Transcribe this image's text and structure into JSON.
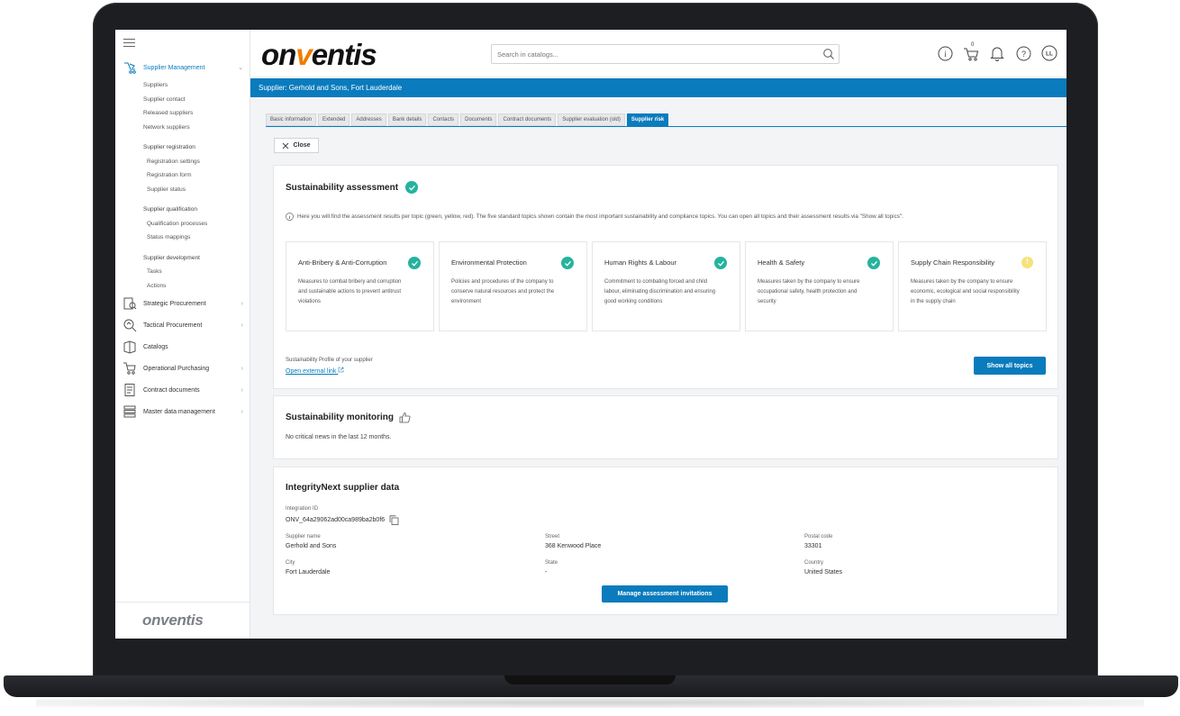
{
  "sidebar": {
    "supplier_management": "Supplier Management",
    "suppliers": "Suppliers",
    "supplier_contact": "Supplier contact",
    "released_suppliers": "Released suppliers",
    "network_suppliers": "Network suppliers",
    "supplier_registration": "Supplier registration",
    "registration_settings": "Registration settings",
    "registration_form": "Registration form",
    "supplier_status": "Supplier status",
    "supplier_qualification": "Supplier qualification",
    "qualification_processes": "Qualification processes",
    "status_mappings": "Status mappings",
    "supplier_development": "Supplier development",
    "tasks": "Tasks",
    "actions": "Actions",
    "strategic_procurement": "Strategic Procurement",
    "tactical_procurement": "Tactical Procurement",
    "catalogs": "Catalogs",
    "operational_purchasing": "Operational Purchasing",
    "contract_documents": "Contract documents",
    "master_data_management": "Master data management",
    "footer_logo": "onventis"
  },
  "header": {
    "logo_pre": "on",
    "logo_v": "v",
    "logo_post": "entis",
    "search_placeholder": "Search in catalogs...",
    "cart_count": "0",
    "user_initials": "LL",
    "help_glyph": "?",
    "info_glyph": "i"
  },
  "page": {
    "title": "Supplier: Gerhold and Sons, Fort Lauderdale",
    "tabs": [
      "Basic information",
      "Extended",
      "Addresses",
      "Bank details",
      "Contacts",
      "Documents",
      "Contract documents",
      "Supplier evaluation (old)",
      "Supplier risk"
    ],
    "close_label": "Close"
  },
  "assessment": {
    "title": "Sustainability assessment",
    "info": "Here you will find the assessment results per topic (green, yellow, red). The five standard topics shown contain the most important sustainability and compliance topics. You can open all topics and their assessment results via \"Show all topics\".",
    "topics": [
      {
        "title": "Anti-Bribery & Anti-Corruption",
        "desc": "Measures to combat bribery and corruption and sustainable actions to prevent antitrust violations",
        "status": "green"
      },
      {
        "title": "Environmental Protection",
        "desc": "Policies and procedures of the company to conserve natural resources and protect the environment",
        "status": "green"
      },
      {
        "title": "Human Rights & Labour",
        "desc": "Commitment to combating forced and child labour, eliminating discrimination and ensuring good working conditions",
        "status": "green"
      },
      {
        "title": "Health & Safety",
        "desc": "Measures taken by the company to ensure occupational safety, health protection and security",
        "status": "green"
      },
      {
        "title": "Supply Chain Responsibility",
        "desc": "Measures taken by the company to ensure economic, ecological and social responsibility in the supply chain",
        "status": "yellow"
      }
    ],
    "profile_label": "Sustainability Profile of your supplier",
    "profile_link": "Open external link",
    "show_all": "Show all topics"
  },
  "monitoring": {
    "title": "Sustainability monitoring",
    "text": "No critical news in the last 12 months."
  },
  "integrity": {
    "title": "IntegrityNext supplier data",
    "integration_id_label": "Integration ID",
    "integration_id": "ONV_64a29062ad00ca989ba2b0f6",
    "supplier_name_label": "Supplier name",
    "supplier_name": "Gerhold and Sons",
    "street_label": "Street",
    "street": "368 Kenwood Place",
    "postal_code_label": "Postal code",
    "postal_code": "33301",
    "city_label": "City",
    "city": "Fort Lauderdale",
    "state_label": "State",
    "state": "-",
    "country_label": "Country",
    "country": "United States",
    "manage_button": "Manage assessment invitations"
  },
  "colors": {
    "brand_blue": "#0a7bbd",
    "logo_orange": "#f07d00",
    "status_green": "#25b39e",
    "status_yellow": "#f6e27a"
  }
}
